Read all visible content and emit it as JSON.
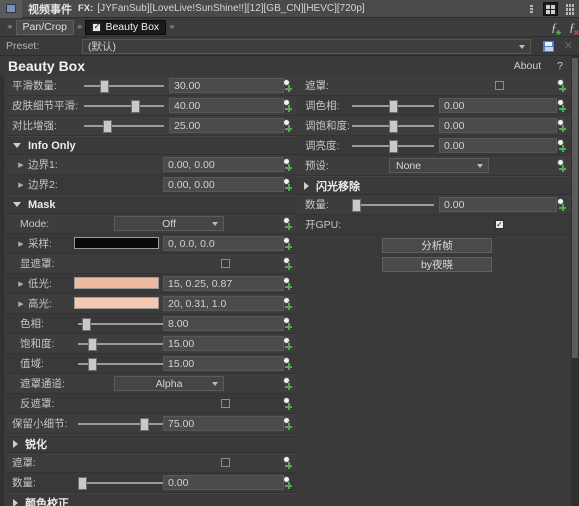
{
  "titlebar": {
    "title": "视频事件",
    "fx_label": "FX:",
    "filename": "[JYFanSub][LoveLive!SunShine!!][12][GB_CN][HEVC][720p]"
  },
  "fxchain": {
    "items": [
      {
        "label": "Pan/Crop",
        "checked": false,
        "active": false
      },
      {
        "label": "Beauty Box",
        "checked": true,
        "active": true
      }
    ],
    "check_glyph": "✓"
  },
  "preset": {
    "label": "Preset:",
    "value": "(默认)"
  },
  "plugin": {
    "title": "Beauty Box",
    "about_label": "About",
    "help_label": "?"
  },
  "main_params": [
    {
      "name": "平滑数量:",
      "value": "30.00",
      "slider": 22
    },
    {
      "name": "皮肤细节平滑:",
      "value": "40.00",
      "slider": 63
    },
    {
      "name": "对比增强:",
      "value": "25.00",
      "slider": 26
    }
  ],
  "right_params": {
    "mask_row": {
      "name": "遮罩:",
      "checked": false
    },
    "sliders": [
      {
        "name": "调色相:",
        "value": "0.00",
        "slider": 50
      },
      {
        "name": "调饱和度:",
        "value": "0.00",
        "slider": 50
      },
      {
        "name": "调亮度:",
        "value": "0.00",
        "slider": 50
      }
    ],
    "preset_row": {
      "name": "预设:",
      "value": "None"
    }
  },
  "flicker": {
    "title": "闪光移除",
    "amount": {
      "name": "数量:",
      "value": "0.00",
      "slider": 1
    },
    "gpu": {
      "name": "开GPU:",
      "checked": true
    },
    "buttons": [
      {
        "label": "分析帧"
      },
      {
        "label": "by夜晓"
      }
    ]
  },
  "info_only": {
    "title": "Info Only",
    "rows": [
      {
        "name": "边界1:",
        "value": "0.00, 0.00"
      },
      {
        "name": "边界2:",
        "value": "0.00, 0.00"
      }
    ]
  },
  "mask_section": {
    "title": "Mask",
    "mode": {
      "name": "Mode:",
      "value": "Off"
    },
    "sample": {
      "name": "采样:",
      "value": "0, 0.0, 0.0",
      "color": "#0a0a0a"
    },
    "show_mask": {
      "name": "显遮罩:",
      "checked": false
    },
    "lowlight": {
      "name": "低光:",
      "value": "15, 0.25, 0.87",
      "color": "#eebaa4"
    },
    "highlight": {
      "name": "高光:",
      "value": "20, 0.31, 1.0",
      "color": "#f5c8b2"
    },
    "hue": {
      "name": "色相:",
      "value": "8.00",
      "slider": 6
    },
    "saturation": {
      "name": "饱和度:",
      "value": "15.00",
      "slider": 12
    },
    "valuerange": {
      "name": "值域:",
      "value": "15.00",
      "slider": 12
    },
    "channel": {
      "name": "遮罩通道:",
      "value": "Alpha"
    },
    "invert": {
      "name": "反遮罩:",
      "checked": false
    },
    "detail": {
      "name": "保留小细节:",
      "value": "75.00",
      "slider": 75
    }
  },
  "sharpen_section": {
    "title": "锐化",
    "mask": {
      "name": "遮罩:",
      "checked": false
    },
    "amount": {
      "name": "数量:",
      "value": "0.00",
      "slider": 1
    }
  },
  "color_section": {
    "title": "颜色校正"
  },
  "colors": {
    "panel_bg": "#3a3a3a",
    "row_bg": "#3d3d3d",
    "accent_blue": "#5a7fb5",
    "keyframe_green": "#4caf50"
  }
}
